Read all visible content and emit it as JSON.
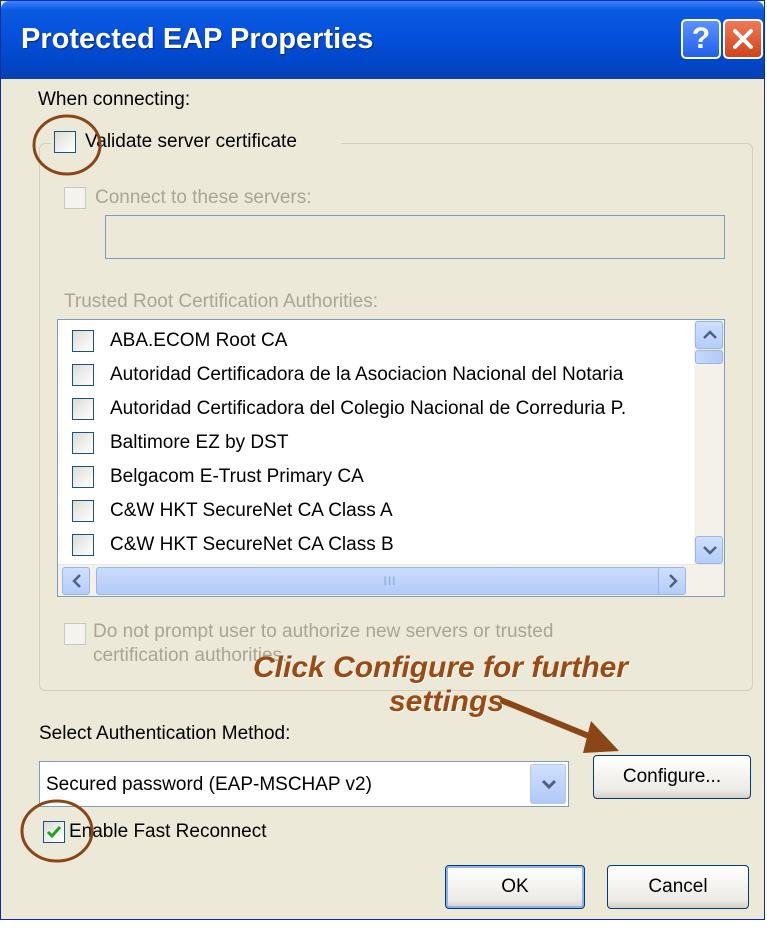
{
  "window": {
    "title": "Protected EAP Properties"
  },
  "titlebar": {
    "help_label": "?"
  },
  "when_connecting_label": "When connecting:",
  "validate_server_cert": {
    "label": "Validate server certificate",
    "checked": false
  },
  "connect_to_servers": {
    "label": "Connect to these servers:",
    "checked": false,
    "value": ""
  },
  "trusted_root_label": "Trusted Root Certification Authorities:",
  "trusted_root_list": [
    {
      "label": "ABA.ECOM Root CA",
      "checked": false
    },
    {
      "label": "Autoridad Certificadora de la Asociacion Nacional del Notaria",
      "checked": false
    },
    {
      "label": "Autoridad Certificadora del Colegio Nacional de Correduria P.",
      "checked": false
    },
    {
      "label": "Baltimore EZ by DST",
      "checked": false
    },
    {
      "label": "Belgacom E-Trust Primary CA",
      "checked": false
    },
    {
      "label": "C&W HKT SecureNet CA Class A",
      "checked": false
    },
    {
      "label": "C&W HKT SecureNet CA Class B",
      "checked": false
    }
  ],
  "scrollbar": {
    "thumb_grip": "III"
  },
  "do_not_prompt": {
    "line1": "Do not prompt user to authorize new servers or trusted",
    "line2": "certification authorities.",
    "checked": false
  },
  "annotation": {
    "line1": "Click Configure for further",
    "line2": "settings",
    "color": "#9a4a12"
  },
  "auth_method_label": "Select Authentication Method:",
  "auth_method_dropdown": {
    "value": "Secured password (EAP-MSCHAP v2)"
  },
  "configure_button": "Configure...",
  "enable_fast_reconnect": {
    "label": "Enable Fast Reconnect",
    "checked": true
  },
  "ok_button": "OK",
  "cancel_button": "Cancel"
}
